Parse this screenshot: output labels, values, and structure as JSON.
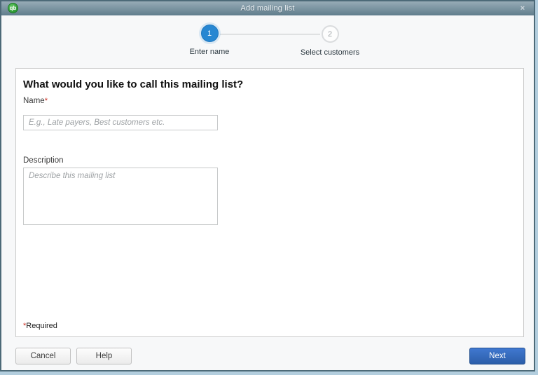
{
  "window": {
    "title": "Add mailing list",
    "app_icon_label": "qb",
    "close_glyph": "×"
  },
  "stepper": {
    "steps": [
      {
        "number": "1",
        "label": "Enter name",
        "state": "active"
      },
      {
        "number": "2",
        "label": "Select customers",
        "state": "inactive"
      }
    ]
  },
  "form": {
    "heading": "What would you like to call this mailing list?",
    "name_label": "Name",
    "required_asterisk": "*",
    "name_placeholder": "E.g., Late payers, Best customers etc.",
    "name_value": "",
    "description_label": "Description",
    "description_placeholder": "Describe this mailing list",
    "description_value": "",
    "required_note": "Required"
  },
  "footer": {
    "cancel_label": "Cancel",
    "help_label": "Help",
    "next_label": "Next"
  },
  "colors": {
    "titlebar_top": "#97abb6",
    "titlebar_bottom": "#63808f",
    "window_border": "#4d6a78",
    "active_step_blue": "#2787d2",
    "next_button_blue": "#2c5ea9",
    "required_red": "#cc2a1e",
    "panel_background": "#ffffff",
    "qb_icon_green": "#2e9a35"
  }
}
